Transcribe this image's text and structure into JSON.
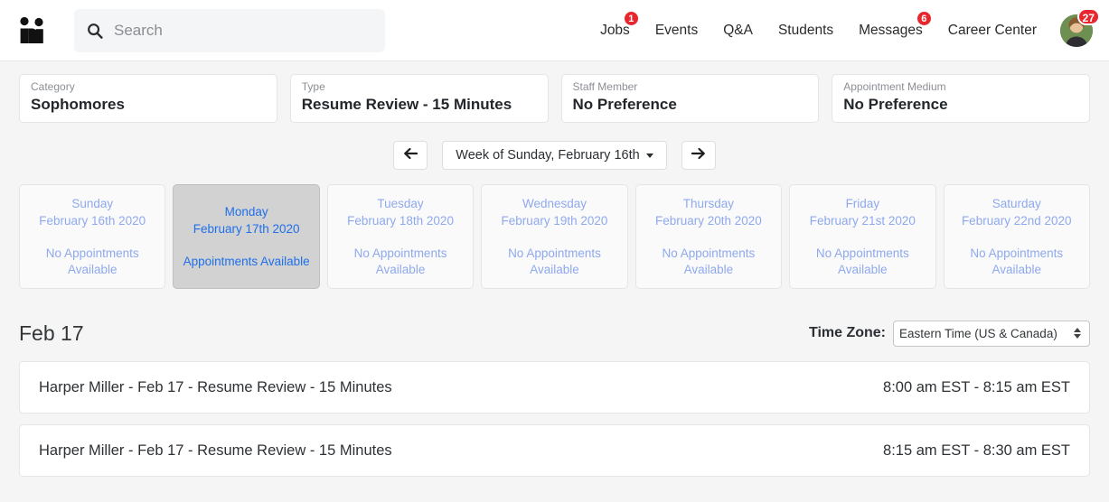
{
  "header": {
    "logo_name": "handshake-logo",
    "search": {
      "value": "",
      "placeholder": "Search"
    },
    "nav": [
      {
        "label": "Jobs",
        "badge": "1"
      },
      {
        "label": "Events",
        "badge": ""
      },
      {
        "label": "Q&A",
        "badge": ""
      },
      {
        "label": "Students",
        "badge": ""
      },
      {
        "label": "Messages",
        "badge": "6"
      },
      {
        "label": "Career Center",
        "badge": ""
      }
    ],
    "avatar_badge": "27",
    "badge_color": "#e8262d"
  },
  "filters": [
    {
      "label": "Category",
      "value": "Sophomores"
    },
    {
      "label": "Type",
      "value": "Resume Review - 15 Minutes"
    },
    {
      "label": "Staff Member",
      "value": "No Preference"
    },
    {
      "label": "Appointment Medium",
      "value": "No Preference"
    }
  ],
  "week_nav": {
    "prev_label": "←",
    "next_label": "→",
    "week_label": "Week of Sunday, February 16th"
  },
  "days": [
    {
      "name": "Sunday",
      "date": "February 16th 2020",
      "status": "No Appointments Available",
      "selected": false
    },
    {
      "name": "Monday",
      "date": "February 17th 2020",
      "status": "Appointments Available",
      "selected": true
    },
    {
      "name": "Tuesday",
      "date": "February 18th 2020",
      "status": "No Appointments Available",
      "selected": false
    },
    {
      "name": "Wednesday",
      "date": "February 19th 2020",
      "status": "No Appointments Available",
      "selected": false
    },
    {
      "name": "Thursday",
      "date": "February 20th 2020",
      "status": "No Appointments Available",
      "selected": false
    },
    {
      "name": "Friday",
      "date": "February 21st 2020",
      "status": "No Appointments Available",
      "selected": false
    },
    {
      "name": "Saturday",
      "date": "February 22nd 2020",
      "status": "No Appointments Available",
      "selected": false
    }
  ],
  "section": {
    "title": "Feb 17",
    "timezone_label": "Time Zone:",
    "timezone_value": "Eastern Time (US & Canada)"
  },
  "appointments": [
    {
      "title": "Harper Miller - Feb 17 - Resume Review - 15 Minutes",
      "time": "8:00 am EST - 8:15 am EST"
    },
    {
      "title": "Harper Miller - Feb 17 - Resume Review - 15 Minutes",
      "time": "8:15 am EST - 8:30 am EST"
    }
  ],
  "colors": {
    "selected_day_bg": "#d2d2d2",
    "selected_day_text": "#1f6fea",
    "muted_day_text": "#8fa9ef",
    "page_bg": "#f5f5f5"
  }
}
